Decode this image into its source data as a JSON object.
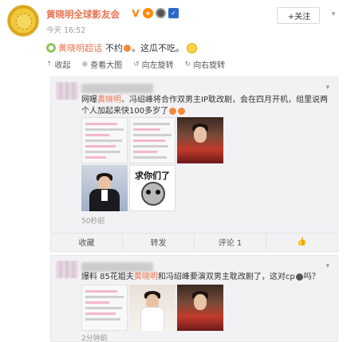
{
  "header": {
    "author": "黄晓明全球影友会",
    "time": "今天 16:52",
    "follow_label": "+关注"
  },
  "post": {
    "topic": "黄晓明超话",
    "text": "不约",
    "text_after": "。这瓜不吃。"
  },
  "toolbar": {
    "collapse": "收起",
    "view_large": "查看大图",
    "rotate_left": "向左旋转",
    "rotate_right": "向右旋转"
  },
  "card1": {
    "text_prefix": "网曝",
    "text_name": "黄晓明",
    "text_body": "、冯绍峰将合作双男主IP耽改剧，会在四月开机，组里说两个人加起来快100多岁了",
    "meme_text": "求你们了",
    "time": "50秒前",
    "actions": [
      "收藏",
      "转发",
      "评论 1",
      ""
    ]
  },
  "card2": {
    "text_prefix": "爆料 85花姐夫",
    "text_name": "黄晓明",
    "text_body": "和冯绍峰要演双男主耽改剧了，这对cp",
    "text_suffix": "吗？",
    "time": "2分钟前"
  },
  "colors": {
    "accent": "#eb7350",
    "follow_plus": "#ff8200",
    "card_bg": "#f2f2f5"
  }
}
